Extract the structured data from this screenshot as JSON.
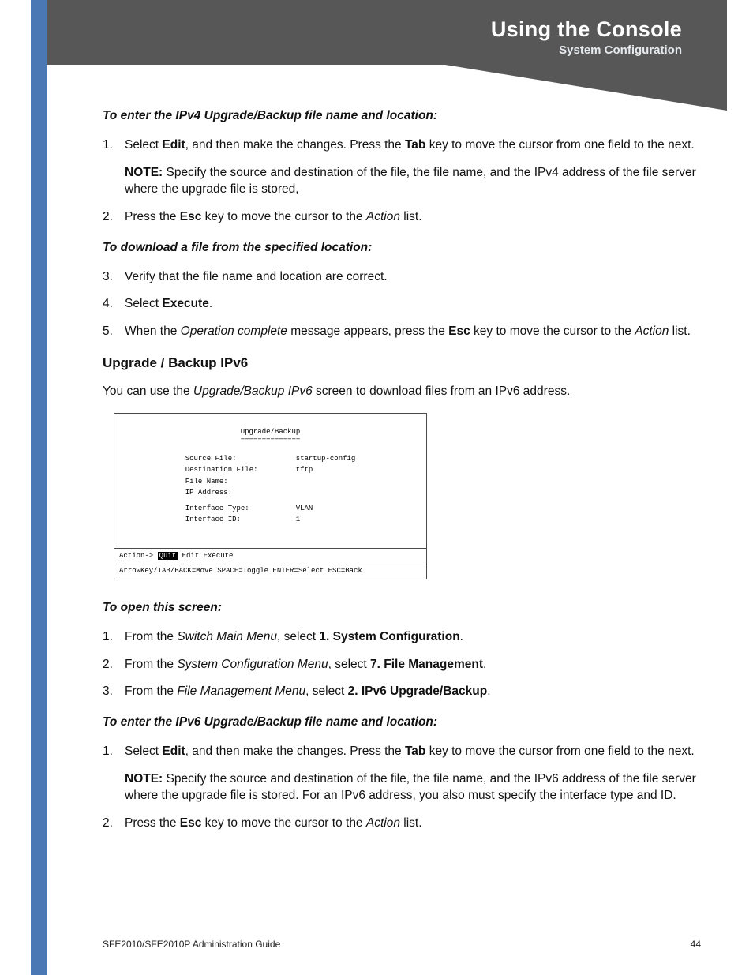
{
  "header": {
    "title": "Using the Console",
    "subtitle": "System Configuration"
  },
  "sec1_lead": "To enter the IPv4 Upgrade/Backup file name and location:",
  "s1n1": "1.",
  "s1t1a": "Select ",
  "s1t1b": "Edit",
  "s1t1c": ", and then make the changes. Press the ",
  "s1t1d": "Tab",
  "s1t1e": " key to move the cursor from one field to the next.",
  "s1note_a": "NOTE: ",
  "s1note_b": "Specify the source and destination of the file, the file name, and the IPv4 address of the file server where the upgrade file is stored,",
  "s1n2": "2.",
  "s1t2a": "Press the ",
  "s1t2b": "Esc",
  "s1t2c": " key to move the cursor to the ",
  "s1t2d": "Action",
  "s1t2e": " list.",
  "sec2_lead": "To download a file from the specified location:",
  "s2n3": "3.",
  "s2t3": "Verify that the file name and location are correct.",
  "s2n4": "4.",
  "s2t4a": "Select ",
  "s2t4b": "Execute",
  "s2t4c": ".",
  "s2n5": "5.",
  "s2t5a": "When the ",
  "s2t5b": "Operation complete",
  "s2t5c": " message appears, press the ",
  "s2t5d": "Esc",
  "s2t5e": " key to move the cursor to the ",
  "s2t5f": "Action",
  "s2t5g": " list.",
  "h3": "Upgrade / Backup IPv6",
  "intro_a": "You can use the ",
  "intro_b": "Upgrade/Backup IPv6",
  "intro_c": " screen to download files from an IPv6 address.",
  "console": {
    "title": "Upgrade/Backup",
    "underline": "==============",
    "rows": [
      {
        "label": "Source File:",
        "value": "startup-config"
      },
      {
        "label": "Destination File:",
        "value": "tftp"
      },
      {
        "label": "File Name:",
        "value": ""
      },
      {
        "label": "IP Address:",
        "value": ""
      }
    ],
    "rows2": [
      {
        "label": "Interface Type:",
        "value": "VLAN"
      },
      {
        "label": "Interface ID:",
        "value": "1"
      }
    ],
    "action_prefix": "Action-> ",
    "action_sel": "Quit",
    "action_rest": "   Edit   Execute",
    "hint": "ArrowKey/TAB/BACK=Move  SPACE=Toggle  ENTER=Select  ESC=Back"
  },
  "sec3_lead": "To open this screen:",
  "s3n1": "1.",
  "s3t1a": "From the ",
  "s3t1b": "Switch Main Menu",
  "s3t1c": ", select ",
  "s3t1d": "1. System Configuration",
  "s3t1e": ".",
  "s3n2": "2.",
  "s3t2a": "From the ",
  "s3t2b": "System Configuration Menu",
  "s3t2c": ", select ",
  "s3t2d": "7. File Management",
  "s3t2e": ".",
  "s3n3": "3.",
  "s3t3a": "From the ",
  "s3t3b": "File Management Menu",
  "s3t3c": ", select ",
  "s3t3d": "2. IPv6 Upgrade/Backup",
  "s3t3e": ".",
  "sec4_lead": "To enter the IPv6 Upgrade/Backup file name and location:",
  "s4n1": "1.",
  "s4t1a": "Select ",
  "s4t1b": "Edit",
  "s4t1c": ", and then make the changes. Press the ",
  "s4t1d": "Tab",
  "s4t1e": " key to move the cursor from one field to the next.",
  "s4note_a": "NOTE: ",
  "s4note_b": "Specify the source and destination of the file, the file name, and the IPv6 address of the file server where the upgrade file is stored. For an IPv6 address, you also must specify the interface type and ID.",
  "s4n2": "2.",
  "s4t2a": "Press the ",
  "s4t2b": "Esc",
  "s4t2c": " key to move the cursor to the ",
  "s4t2d": "Action",
  "s4t2e": " list.",
  "footer": {
    "left": "SFE2010/SFE2010P Administration Guide",
    "right": "44"
  }
}
